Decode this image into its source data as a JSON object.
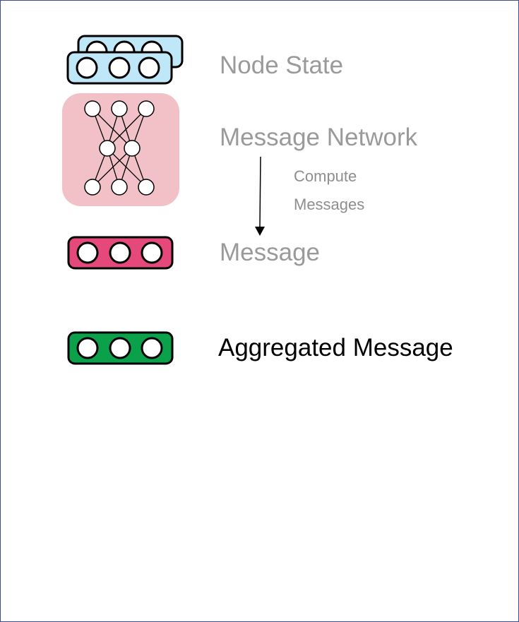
{
  "legend": {
    "node_state": {
      "label": "Node State",
      "color": "#bfe7f7",
      "text_color": "#9a9a9a"
    },
    "message_network": {
      "label": "Message Network",
      "color": "#f2c1c8",
      "text_color": "#9a9a9a"
    },
    "message": {
      "label": "Message",
      "color": "#e5487b",
      "text_color": "#9a9a9a"
    },
    "aggregated_message": {
      "label": "Aggregated Message",
      "color": "#0aa14a",
      "text_color": "#000000"
    }
  },
  "arrow": {
    "label_line1": "Compute",
    "label_line2": "Messages",
    "color": "#000000"
  }
}
